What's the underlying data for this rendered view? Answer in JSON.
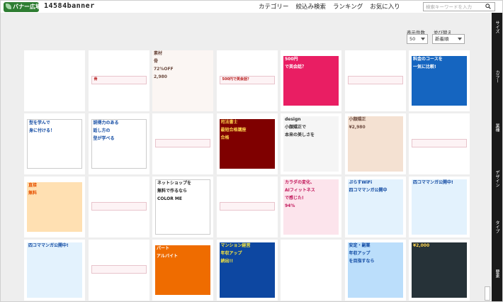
{
  "header": {
    "logo_text": "バナー広場",
    "site_code": "14584banner",
    "nav": [
      "カテゴリー",
      "絞込み検索",
      "ランキング",
      "お気に入り"
    ],
    "search_placeholder": "検索キーワードを入力"
  },
  "controls": {
    "display_count_label": "表示件数",
    "display_count_value": "50",
    "sort_label": "並び替え",
    "sort_value": "新着順"
  },
  "rail": {
    "tabs": [
      "サイズ",
      "カラー",
      "業種",
      "デザイン",
      "タイプ",
      "要素"
    ]
  },
  "banners": [
    {
      "style": "blank"
    },
    {
      "style": "thin-strip",
      "texts": [
        "骨"
      ]
    },
    {
      "style": "photo-ad",
      "texts": [
        "素材",
        "骨",
        "72%OFF",
        "2,980"
      ]
    },
    {
      "style": "thin-strip",
      "texts": [
        "500円で英会話？"
      ]
    },
    {
      "style": "pink",
      "texts": [
        "500円",
        "で英会話？"
      ]
    },
    {
      "style": "thin-strip",
      "texts": []
    },
    {
      "style": "info",
      "texts": [
        "料金のコースを",
        "一気に比較!"
      ]
    },
    {
      "style": "business",
      "texts": [
        "型を学んで",
        "身に付ける！"
      ]
    },
    {
      "style": "business",
      "texts": [
        "説得力のある",
        "話し方の",
        "型が学べる"
      ]
    },
    {
      "style": "thin-strip",
      "texts": []
    },
    {
      "style": "dark-red",
      "texts": [
        "司法書士",
        "最短合格講座",
        "合格"
      ]
    },
    {
      "style": "portrait",
      "texts": [
        "design",
        "小顔矯正で",
        "本来の美しさを"
      ]
    },
    {
      "style": "beige",
      "texts": [
        "小顔矯正",
        "¥2,980"
      ]
    },
    {
      "style": "thin-strip",
      "texts": []
    },
    {
      "style": "orange",
      "texts": [
        "直接",
        "無料"
      ]
    },
    {
      "style": "thin-strip",
      "texts": []
    },
    {
      "style": "shop",
      "texts": [
        "ネットショップを",
        "無料で作るなら",
        "COLOR ME"
      ]
    },
    {
      "style": "thin-strip",
      "texts": []
    },
    {
      "style": "fitness",
      "texts": [
        "カラダの変化、",
        "AIフィットネス",
        "で感じた!",
        "94%"
      ]
    },
    {
      "style": "manga",
      "texts": [
        "ぷらすWiFi",
        "四コママンガ公開中"
      ]
    },
    {
      "style": "manga",
      "texts": [
        "四コママンガ公開中!"
      ]
    },
    {
      "style": "manga",
      "texts": [
        "四コママンガ公開中!"
      ]
    },
    {
      "style": "thin-strip",
      "texts": []
    },
    {
      "style": "orange2",
      "texts": [
        "パート",
        "アルバイト"
      ]
    },
    {
      "style": "blue",
      "texts": [
        "マンション経営",
        "年収アップ",
        "続出!!"
      ]
    },
    {
      "style": "blank"
    },
    {
      "style": "blue2",
      "texts": [
        "安定・副業",
        "年収アップ",
        "を目指すなら"
      ]
    },
    {
      "style": "dark",
      "texts": [
        "¥2,000"
      ]
    }
  ]
}
